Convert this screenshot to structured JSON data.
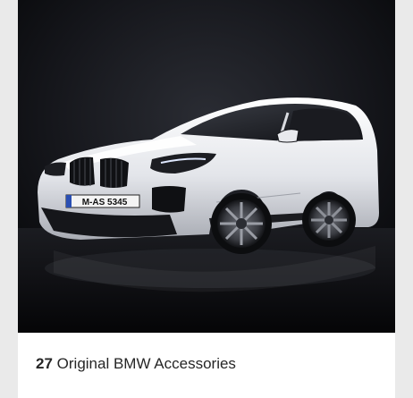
{
  "product_card": {
    "image_icon": "car-photo",
    "plate_text": "M-AS 5345",
    "count": "27",
    "title": "Original BMW Accessories"
  },
  "colors": {
    "page_background": "#eaeaea",
    "card_background": "#ffffff",
    "photo_background": "#0e0f13",
    "text": "#262626"
  }
}
